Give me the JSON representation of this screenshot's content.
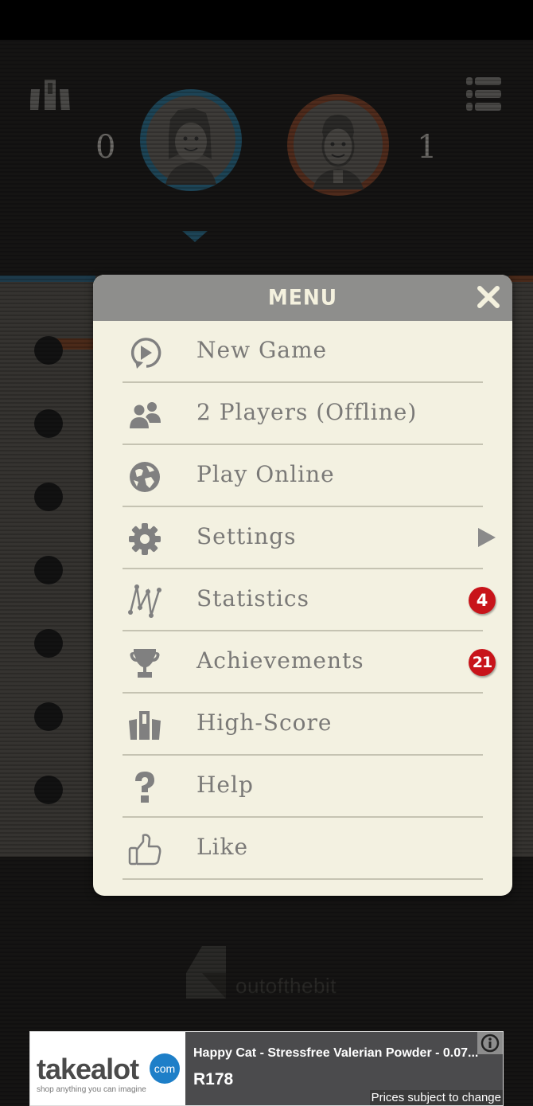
{
  "scores": {
    "player1": "0",
    "player2": "1"
  },
  "colors": {
    "player1_ring": "#1d4456",
    "player2_ring": "#4f2b1c",
    "menu_header": "#8e8e8c",
    "menu_bg": "#f3f1e1",
    "badge": "#c8141a",
    "ad_brand_blue": "#1e7fc8"
  },
  "menu": {
    "title": "MENU",
    "close_icon": "close-icon",
    "items": [
      {
        "label": "New Game",
        "icon": "play-restart-icon"
      },
      {
        "label": "2 Players (Offline)",
        "icon": "two-players-icon"
      },
      {
        "label": "Play Online",
        "icon": "globe-icon"
      },
      {
        "label": "Settings",
        "icon": "gear-icon",
        "submenu": true
      },
      {
        "label": "Statistics",
        "icon": "statistics-icon",
        "badge": "4"
      },
      {
        "label": "Achievements",
        "icon": "trophy-icon",
        "badge": "21"
      },
      {
        "label": "High-Score",
        "icon": "podium-icon"
      },
      {
        "label": "Help",
        "icon": "question-icon"
      },
      {
        "label": "Like",
        "icon": "thumbs-up-icon"
      }
    ]
  },
  "footer": {
    "logo_text": "outofthebit"
  },
  "ad": {
    "brand": "takealot",
    "brand_suffix": "com",
    "tagline": "shop anything you can imagine",
    "title": "Happy Cat - Stressfree Valerian Powder - 0.07...",
    "price": "R178",
    "note": "Prices subject to change"
  }
}
